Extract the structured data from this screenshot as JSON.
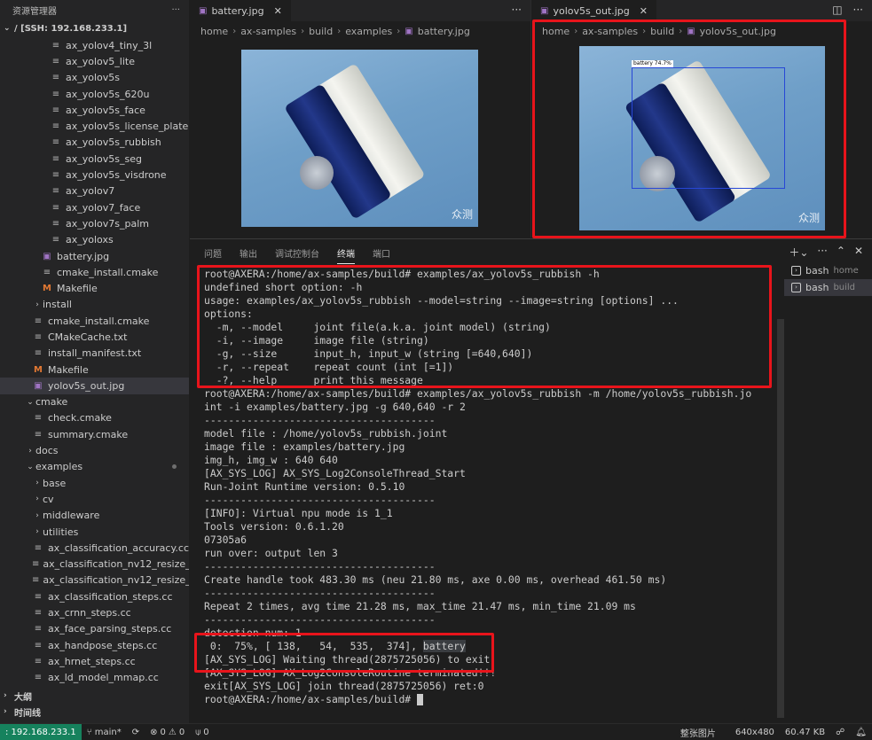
{
  "sidebar": {
    "title": "资源管理器",
    "more_icon": "ellipsis-icon",
    "root": "/ [SSH: 192.168.233.1]",
    "items": [
      {
        "label": "ax_yolov4_tiny_3l",
        "indent": 3,
        "icon": "ts"
      },
      {
        "label": "ax_yolov5_lite",
        "indent": 3,
        "icon": "ts"
      },
      {
        "label": "ax_yolov5s",
        "indent": 3,
        "icon": "ts"
      },
      {
        "label": "ax_yolov5s_620u",
        "indent": 3,
        "icon": "ts"
      },
      {
        "label": "ax_yolov5s_face",
        "indent": 3,
        "icon": "ts"
      },
      {
        "label": "ax_yolov5s_license_plate",
        "indent": 3,
        "icon": "ts"
      },
      {
        "label": "ax_yolov5s_rubbish",
        "indent": 3,
        "icon": "ts"
      },
      {
        "label": "ax_yolov5s_seg",
        "indent": 3,
        "icon": "ts"
      },
      {
        "label": "ax_yolov5s_visdrone",
        "indent": 3,
        "icon": "ts"
      },
      {
        "label": "ax_yolov7",
        "indent": 3,
        "icon": "ts"
      },
      {
        "label": "ax_yolov7_face",
        "indent": 3,
        "icon": "ts"
      },
      {
        "label": "ax_yolov7s_palm",
        "indent": 3,
        "icon": "ts"
      },
      {
        "label": "ax_yoloxs",
        "indent": 3,
        "icon": "ts"
      },
      {
        "label": "battery.jpg",
        "indent": 2,
        "icon": "img"
      },
      {
        "label": "cmake_install.cmake",
        "indent": 2,
        "icon": "ts"
      },
      {
        "label": "Makefile",
        "indent": 2,
        "icon": "mk"
      },
      {
        "label": "install",
        "indent": 1,
        "icon": "chev"
      },
      {
        "label": "cmake_install.cmake",
        "indent": 1,
        "icon": "ts"
      },
      {
        "label": "CMakeCache.txt",
        "indent": 1,
        "icon": "ts"
      },
      {
        "label": "install_manifest.txt",
        "indent": 1,
        "icon": "ts"
      },
      {
        "label": "Makefile",
        "indent": 1,
        "icon": "mk"
      },
      {
        "label": "yolov5s_out.jpg",
        "indent": 1,
        "icon": "img",
        "selected": true
      },
      {
        "label": "cmake",
        "indent": 0,
        "icon": "chevopen"
      },
      {
        "label": "check.cmake",
        "indent": 1,
        "icon": "ts"
      },
      {
        "label": "summary.cmake",
        "indent": 1,
        "icon": "ts"
      },
      {
        "label": "docs",
        "indent": 0,
        "icon": "chev"
      },
      {
        "label": "examples",
        "indent": 0,
        "icon": "chevopen",
        "dot": true
      },
      {
        "label": "base",
        "indent": 1,
        "icon": "chev"
      },
      {
        "label": "cv",
        "indent": 1,
        "icon": "chev"
      },
      {
        "label": "middleware",
        "indent": 1,
        "icon": "chev"
      },
      {
        "label": "utilities",
        "indent": 1,
        "icon": "chev"
      },
      {
        "label": "ax_classification_accuracy.cc",
        "indent": 1,
        "icon": "cc"
      },
      {
        "label": "ax_classification_nv12_resize_...",
        "indent": 1,
        "icon": "cc"
      },
      {
        "label": "ax_classification_nv12_resize_s...",
        "indent": 1,
        "icon": "cc"
      },
      {
        "label": "ax_classification_steps.cc",
        "indent": 1,
        "icon": "cc"
      },
      {
        "label": "ax_crnn_steps.cc",
        "indent": 1,
        "icon": "cc"
      },
      {
        "label": "ax_face_parsing_steps.cc",
        "indent": 1,
        "icon": "cc"
      },
      {
        "label": "ax_handpose_steps.cc",
        "indent": 1,
        "icon": "cc"
      },
      {
        "label": "ax_hrnet_steps.cc",
        "indent": 1,
        "icon": "cc"
      },
      {
        "label": "ax_ld_model_mmap.cc",
        "indent": 1,
        "icon": "cc"
      }
    ],
    "outline": "大纲",
    "timeline": "时间线"
  },
  "editor_left": {
    "tab": "battery.jpg",
    "breadcrumb": [
      "home",
      "ax-samples",
      "build",
      "examples",
      "battery.jpg"
    ]
  },
  "editor_right": {
    "tab": "yolov5s_out.jpg",
    "breadcrumb": [
      "home",
      "ax-samples",
      "build",
      "yolov5s_out.jpg"
    ],
    "detection_label": "battery 74.7%"
  },
  "image": {
    "watermark": "众测"
  },
  "panel": {
    "tabs": [
      "问题",
      "输出",
      "调试控制台",
      "终端",
      "端口"
    ],
    "active_tab": "终端",
    "terminals": [
      {
        "name": "bash",
        "cwd": "home"
      },
      {
        "name": "bash",
        "cwd": "build"
      }
    ]
  },
  "terminal": {
    "lines": [
      "root@AXERA:/home/ax-samples/build# examples/ax_yolov5s_rubbish -h",
      "undefined short option: -h",
      "usage: examples/ax_yolov5s_rubbish --model=string --image=string [options] ...",
      "options:",
      "  -m, --model     joint file(a.k.a. joint model) (string)",
      "  -i, --image     image file (string)",
      "  -g, --size      input_h, input_w (string [=640,640])",
      "  -r, --repeat    repeat count (int [=1])",
      "  -?, --help      print this message",
      "root@AXERA:/home/ax-samples/build# examples/ax_yolov5s_rubbish -m /home/yolov5s_rubbish.jo",
      "int -i examples/battery.jpg -g 640,640 -r 2",
      "--------------------------------------",
      "model file : /home/yolov5s_rubbish.joint",
      "image file : examples/battery.jpg",
      "img_h, img_w : 640 640",
      "[AX_SYS_LOG] AX_SYS_Log2ConsoleThread_Start",
      "Run-Joint Runtime version: 0.5.10",
      "--------------------------------------",
      "[INFO]: Virtual npu mode is 1_1",
      "",
      "Tools version: 0.6.1.20",
      "07305a6",
      "run over: output len 3",
      "--------------------------------------",
      "Create handle took 483.30 ms (neu 21.80 ms, axe 0.00 ms, overhead 461.50 ms)",
      "--------------------------------------",
      "Repeat 2 times, avg time 21.28 ms, max_time 21.47 ms, min_time 21.09 ms",
      "--------------------------------------",
      "detection num: 1",
      " 0:  75%, [ 138,   54,  535,  374], ",
      "[AX_SYS_LOG] Waiting thread(2875725056) to exit",
      "[AX_SYS_LOG] AX_Log2ConsoleRoutine terminated!!!",
      "exit[AX_SYS_LOG] join thread(2875725056) ret:0",
      "root@AXERA:/home/ax-samples/build# "
    ],
    "highlight_word": "battery"
  },
  "statusbar": {
    "remote": ": 192.168.233.1",
    "branch": "main*",
    "errors": "0",
    "warnings": "0",
    "ports": "0",
    "mode": "整张图片",
    "dimensions": "640x480",
    "size": "60.47 KB"
  }
}
